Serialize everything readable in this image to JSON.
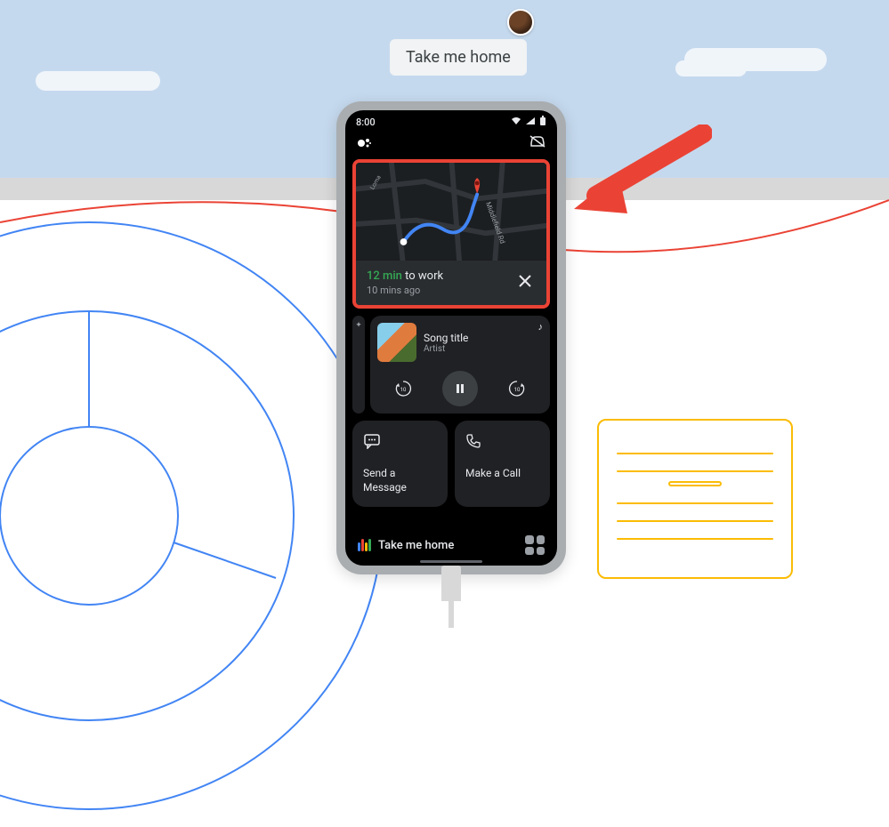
{
  "speech": {
    "text": "Take me home"
  },
  "statusbar": {
    "time": "8:00"
  },
  "nav_card": {
    "eta_value": "12 min",
    "eta_suffix": " to work",
    "timestamp": "10 mins ago",
    "street_label": "Middlefield Rd",
    "side_label": "Loma"
  },
  "media": {
    "title": "Song title",
    "artist": "Artist",
    "back_label": "10",
    "fwd_label": "10"
  },
  "actions": {
    "message": "Send a Message",
    "call": "Make a Call"
  },
  "bottombar": {
    "text": "Take me home"
  },
  "colors": {
    "accent_red": "#ea4335",
    "accent_green": "#34a853",
    "accent_blue": "#4285f4",
    "accent_yellow": "#fbbc04"
  }
}
